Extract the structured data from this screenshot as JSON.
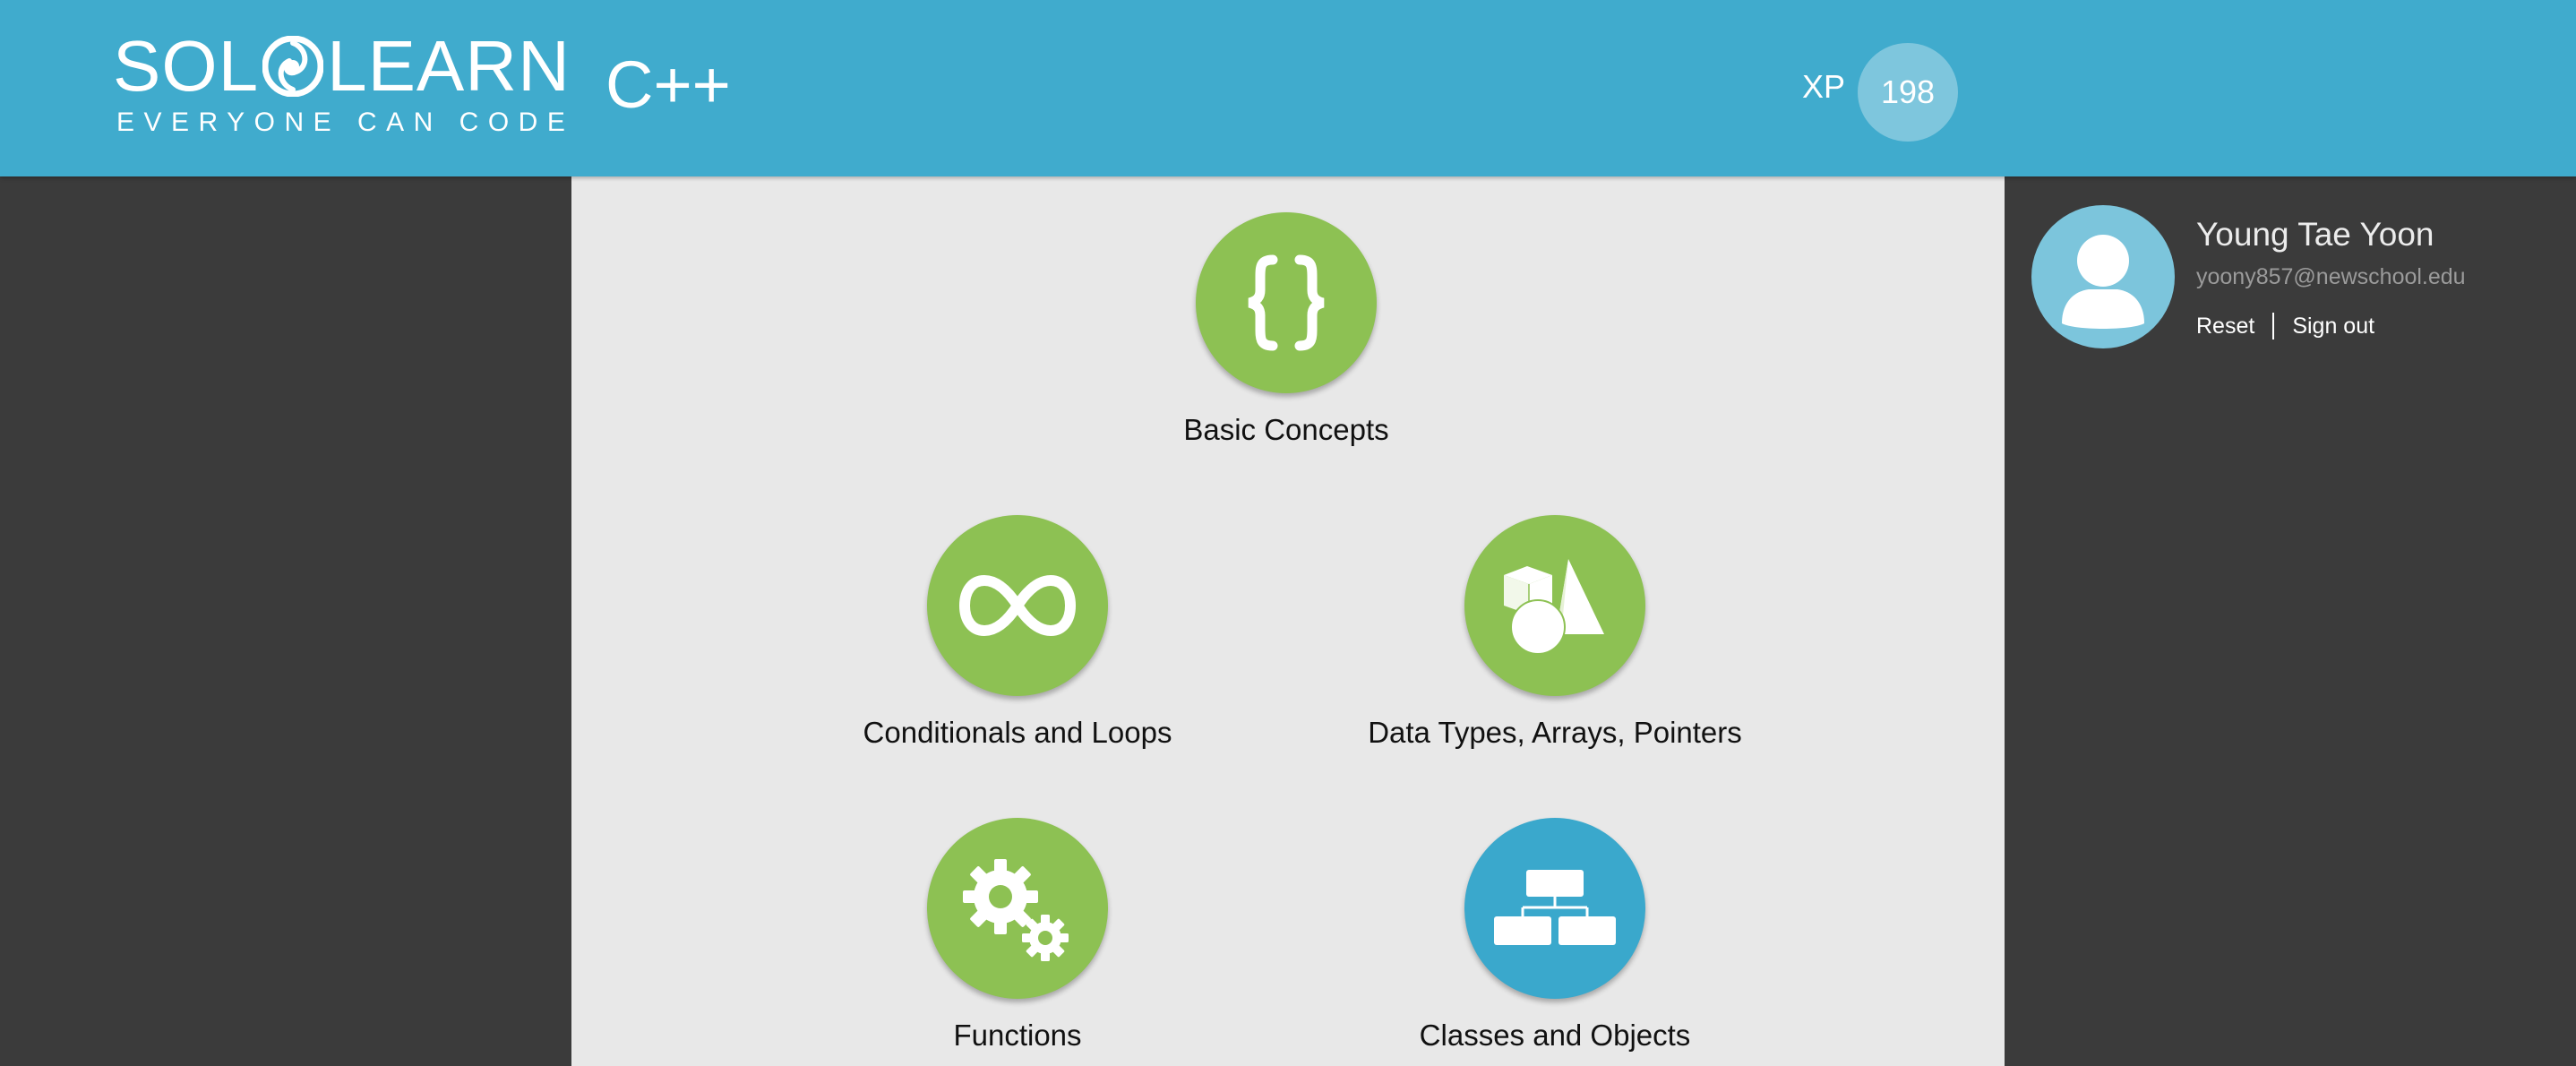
{
  "header": {
    "logo": {
      "word_left": "SOL",
      "word_right": "LEARN",
      "tagline": "EVERYONE CAN CODE"
    },
    "course_title": "C++",
    "xp_label": "XP",
    "xp_value": "198"
  },
  "modules": [
    {
      "label": "Basic Concepts",
      "icon": "curly-braces-icon",
      "color": "#8dc153"
    },
    {
      "label": "Conditionals and Loops",
      "icon": "infinity-icon",
      "color": "#8dc153"
    },
    {
      "label": "Data Types, Arrays, Pointers",
      "icon": "shapes-icon",
      "color": "#8dc153"
    },
    {
      "label": "Functions",
      "icon": "gears-icon",
      "color": "#8dc153"
    },
    {
      "label": "Classes and Objects",
      "icon": "hierarchy-icon",
      "color": "#3aa8cc"
    }
  ],
  "profile": {
    "name": "Young Tae Yoon",
    "email": "yoony857@newschool.edu",
    "reset_label": "Reset",
    "signout_label": "Sign out",
    "avatar_icon": "user-avatar-icon"
  },
  "colors": {
    "header_bg": "#40abcd",
    "page_bg": "#3b3b3b",
    "content_bg": "#e8e8e8",
    "module_green": "#8dc153",
    "module_blue": "#3aa8cc",
    "xp_badge": "#7ec6dd"
  }
}
